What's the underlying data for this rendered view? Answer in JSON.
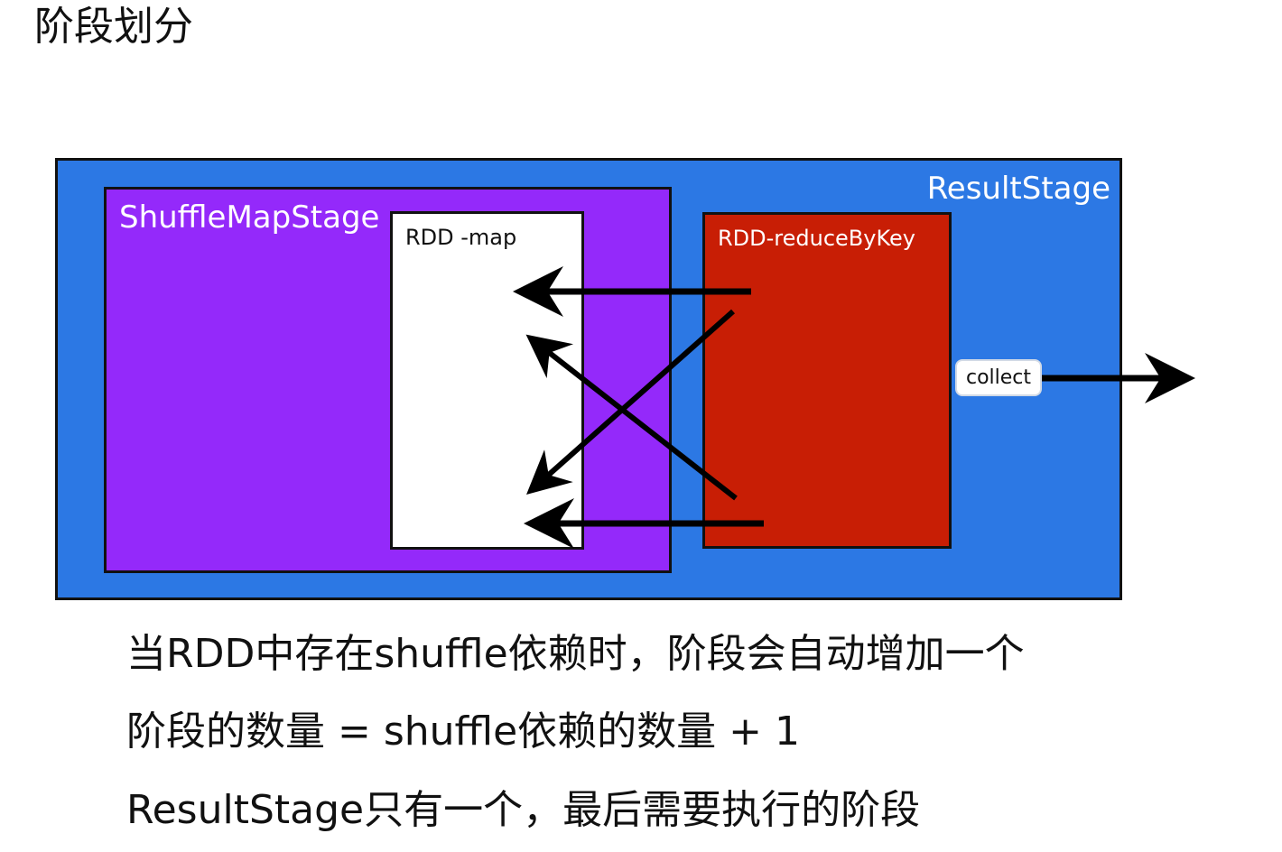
{
  "title": "阶段划分",
  "diagram": {
    "result_stage_label": "ResultStage",
    "shuffle_map_stage_label": "ShuffleMapStage",
    "rdd_map_label": "RDD -map",
    "rdd_reduce_label": "RDD-reduceByKey",
    "collect_label": "collect",
    "colors": {
      "result_stage": "#2c78e4",
      "shuffle_map_stage": "#9429fa",
      "rdd_map": "#ffffff",
      "rdd_reduce": "#c81e05",
      "arrow": "#000000"
    }
  },
  "notes": [
    "当RDD中存在shuffle依赖时，阶段会自动增加一个",
    "阶段的数量 = shuffle依赖的数量 + 1",
    "ResultStage只有一个，最后需要执行的阶段"
  ]
}
